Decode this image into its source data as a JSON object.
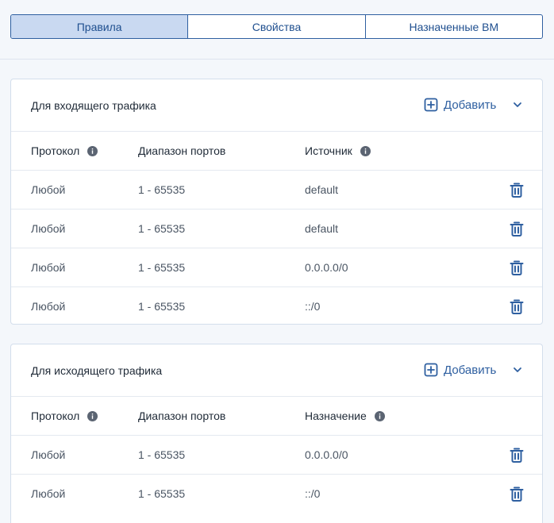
{
  "tabs": [
    {
      "label": "Правила",
      "active": true
    },
    {
      "label": "Свойства",
      "active": false
    },
    {
      "label": "Назначенные ВМ",
      "active": false
    }
  ],
  "inbound": {
    "title": "Для входящего трафика",
    "add_label": "Добавить",
    "add_icon": "plus-square-icon",
    "collapse_icon": "chevron-down-icon",
    "headers": {
      "protocol": "Протокол",
      "ports": "Диапазон портов",
      "peer": "Источник"
    },
    "rows": [
      {
        "protocol": "Любой",
        "ports": "1 - 65535",
        "peer": "default"
      },
      {
        "protocol": "Любой",
        "ports": "1 - 65535",
        "peer": "default"
      },
      {
        "protocol": "Любой",
        "ports": "1 - 65535",
        "peer": "0.0.0.0/0"
      },
      {
        "protocol": "Любой",
        "ports": "1 - 65535",
        "peer": "::/0"
      }
    ]
  },
  "outbound": {
    "title": "Для исходящего трафика",
    "add_label": "Добавить",
    "add_icon": "plus-square-icon",
    "collapse_icon": "chevron-down-icon",
    "headers": {
      "protocol": "Протокол",
      "ports": "Диапазон портов",
      "peer": "Назначение"
    },
    "rows": [
      {
        "protocol": "Любой",
        "ports": "1 - 65535",
        "peer": "0.0.0.0/0"
      },
      {
        "protocol": "Любой",
        "ports": "1 - 65535",
        "peer": "::/0"
      }
    ]
  },
  "colors": {
    "accent": "#2e5fa0",
    "active_tab_bg": "#c9d9f1",
    "info_icon": "#5b6472"
  }
}
